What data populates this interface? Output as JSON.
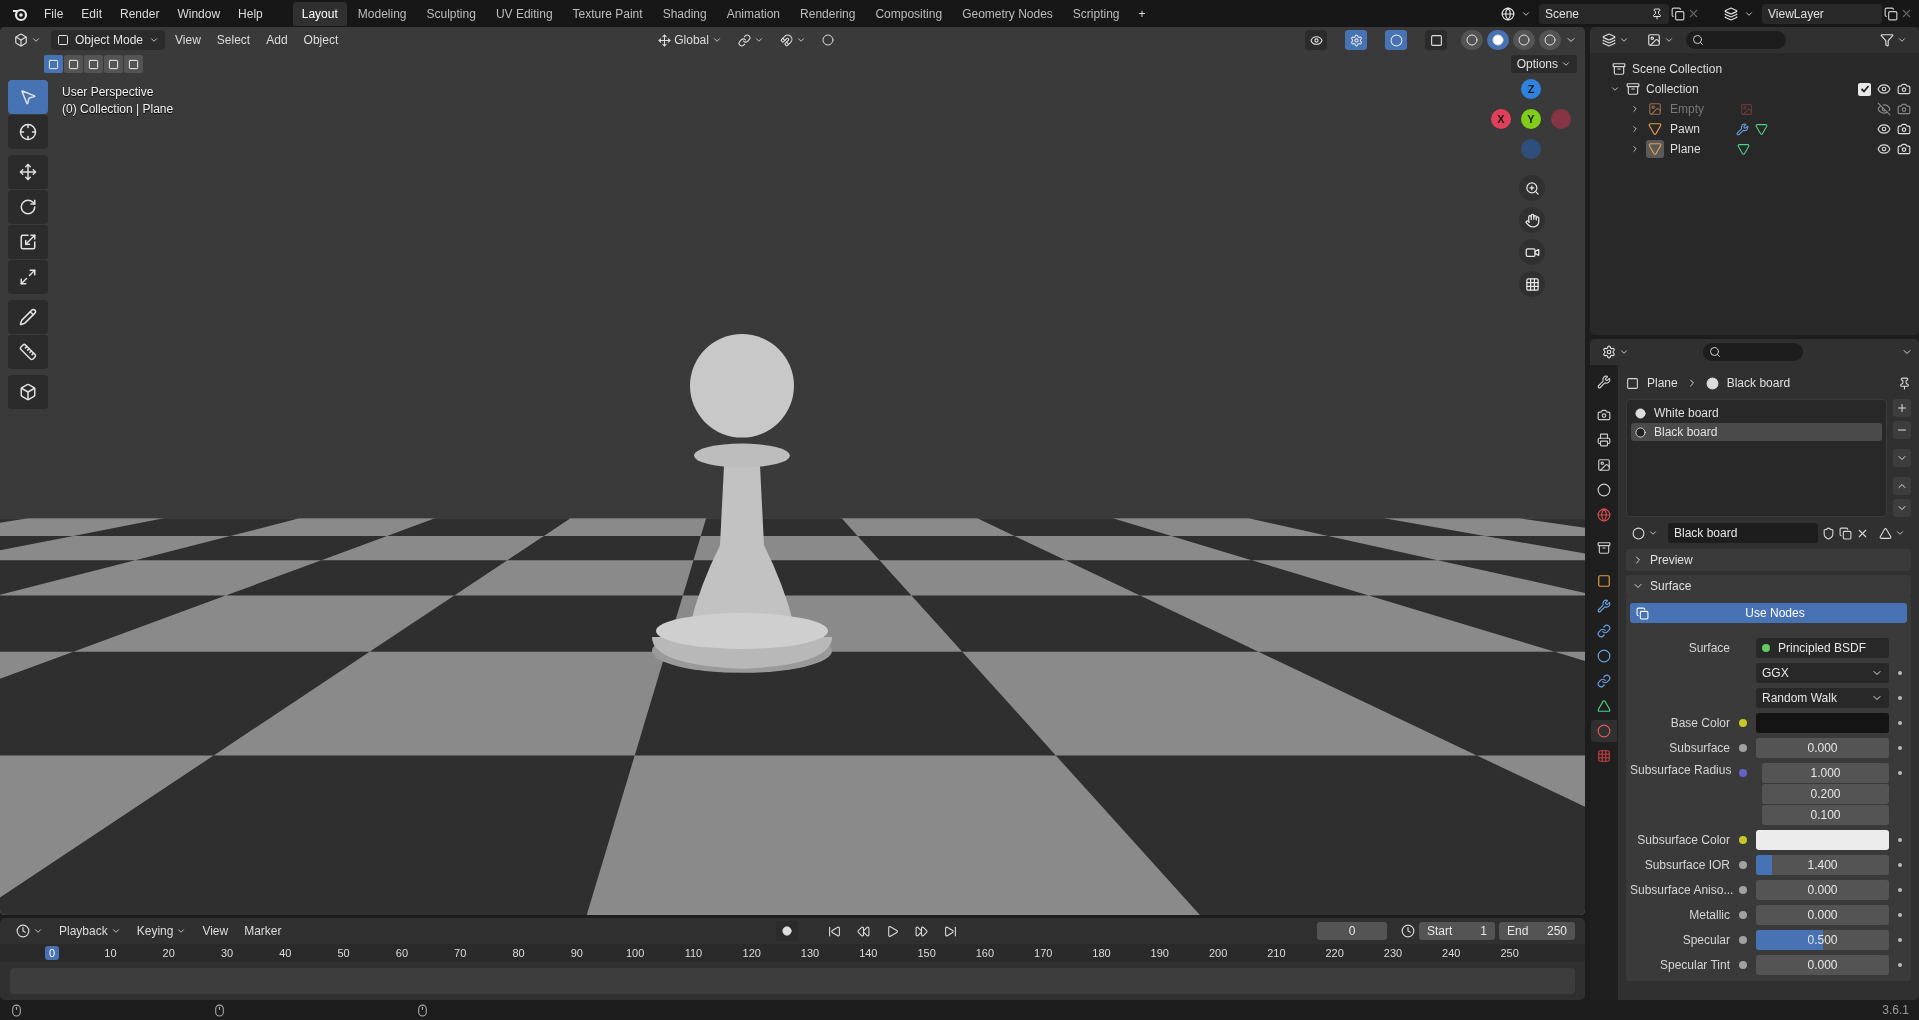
{
  "top_bar": {
    "menus": [
      "File",
      "Edit",
      "Render",
      "Window",
      "Help"
    ],
    "workspaces": [
      {
        "label": "Layout",
        "selected": true
      },
      {
        "label": "Modeling",
        "selected": false
      },
      {
        "label": "Sculpting",
        "selected": false
      },
      {
        "label": "UV Editing",
        "selected": false
      },
      {
        "label": "Texture Paint",
        "selected": false
      },
      {
        "label": "Shading",
        "selected": false
      },
      {
        "label": "Animation",
        "selected": false
      },
      {
        "label": "Rendering",
        "selected": false
      },
      {
        "label": "Compositing",
        "selected": false
      },
      {
        "label": "Geometry Nodes",
        "selected": false
      },
      {
        "label": "Scripting",
        "selected": false
      }
    ],
    "add_workspace": "+",
    "scene": "Scene",
    "view_layer": "ViewLayer"
  },
  "viewport": {
    "mode": "Object Mode",
    "menus": [
      "View",
      "Select",
      "Add",
      "Object"
    ],
    "orientation": "Global",
    "header_toggles": [
      {
        "on": false
      },
      {
        "on": true
      },
      {
        "on": true
      },
      {
        "on": false
      }
    ],
    "shading_modes": [
      {
        "selected": false
      },
      {
        "selected": true
      },
      {
        "selected": false
      },
      {
        "selected": false
      }
    ],
    "select_modes": [
      {
        "selected": true
      },
      {
        "selected": false
      },
      {
        "selected": false
      },
      {
        "selected": false
      },
      {
        "selected": false
      }
    ],
    "options": "Options",
    "info": [
      "User Perspective",
      "(0) Collection | Plane"
    ],
    "tools": [
      {
        "selected": true
      },
      {
        "selected": false
      },
      {
        "selected": false
      },
      {
        "selected": false
      },
      {
        "selected": false
      },
      {
        "selected": false
      },
      {
        "selected": false
      },
      {
        "selected": false
      },
      {
        "selected": false
      }
    ],
    "gizmo": {
      "z": "Z",
      "x": "X",
      "y": "Y"
    }
  },
  "outliner": {
    "root": "Scene Collection",
    "collection": {
      "name": "Collection",
      "checked": true,
      "expanded": true,
      "children": [
        {
          "name": "Empty",
          "kind": "empty",
          "hidden": true,
          "active": false,
          "modifier": false
        },
        {
          "name": "Pawn",
          "kind": "mesh",
          "hidden": false,
          "active": false,
          "modifier": true
        },
        {
          "name": "Plane",
          "kind": "mesh",
          "hidden": false,
          "active": true,
          "modifier": false
        }
      ]
    }
  },
  "properties": {
    "tabs": [
      {
        "selected": false
      },
      {
        "selected": false
      },
      {
        "selected": false
      },
      {
        "selected": false
      },
      {
        "selected": false
      },
      {
        "selected": false
      },
      {
        "selected": false
      },
      {
        "selected": false
      },
      {
        "selected": false
      },
      {
        "selected": false
      },
      {
        "selected": false
      },
      {
        "selected": false
      },
      {
        "selected": false
      },
      {
        "selected": true
      },
      {
        "selected": false
      }
    ],
    "breadcrumb": [
      "Plane",
      "Black board"
    ],
    "slots": [
      {
        "name": "White board",
        "selected": false
      },
      {
        "name": "Black board",
        "selected": true
      }
    ],
    "material": "Black board",
    "panels": [
      {
        "title": "Preview",
        "expanded": false
      },
      {
        "title": "Surface",
        "expanded": true
      }
    ],
    "use_nodes": "Use Nodes",
    "rows": [
      {
        "kind": "link",
        "label": "Surface",
        "value": "Principled BSDF"
      },
      {
        "kind": "dropdown",
        "value": "GGX"
      },
      {
        "kind": "dropdown",
        "value": "Random Walk"
      },
      {
        "kind": "color",
        "label": "Base Color",
        "color": "#141414"
      },
      {
        "kind": "number",
        "label": "Subsurface",
        "value": "0.000"
      },
      {
        "kind": "vector",
        "label": "Subsurface Radius",
        "values": [
          "1.000",
          "0.200",
          "0.100"
        ]
      },
      {
        "kind": "color",
        "label": "Subsurface Color",
        "color": "#ececec"
      },
      {
        "kind": "slider",
        "label": "Subsurface IOR",
        "value": "1.400",
        "level": 0.12
      },
      {
        "kind": "number",
        "label": "Subsurface Aniso...",
        "value": "0.000"
      },
      {
        "kind": "number",
        "label": "Metallic",
        "value": "0.000"
      },
      {
        "kind": "slider",
        "label": "Specular",
        "value": "0.500",
        "level": 0.5
      },
      {
        "kind": "number",
        "label": "Specular Tint",
        "value": "0.000"
      }
    ]
  },
  "timeline": {
    "menus": [
      "Playback",
      "Keying",
      "View",
      "Marker"
    ],
    "current": "0",
    "start_label": "Start",
    "start": "1",
    "end_label": "End",
    "end": "250",
    "frames": [
      {
        "label": "0",
        "selected": true
      },
      {
        "label": "10",
        "selected": false
      },
      {
        "label": "20",
        "selected": false
      },
      {
        "label": "30",
        "selected": false
      },
      {
        "label": "40",
        "selected": false
      },
      {
        "label": "50",
        "selected": false
      },
      {
        "label": "60",
        "selected": false
      },
      {
        "label": "70",
        "selected": false
      },
      {
        "label": "80",
        "selected": false
      },
      {
        "label": "90",
        "selected": false
      },
      {
        "label": "100",
        "selected": false
      },
      {
        "label": "110",
        "selected": false
      },
      {
        "label": "120",
        "selected": false
      },
      {
        "label": "130",
        "selected": false
      },
      {
        "label": "140",
        "selected": false
      },
      {
        "label": "150",
        "selected": false
      },
      {
        "label": "160",
        "selected": false
      },
      {
        "label": "170",
        "selected": false
      },
      {
        "label": "180",
        "selected": false
      },
      {
        "label": "190",
        "selected": false
      },
      {
        "label": "200",
        "selected": false
      },
      {
        "label": "210",
        "selected": false
      },
      {
        "label": "220",
        "selected": false
      },
      {
        "label": "230",
        "selected": false
      },
      {
        "label": "240",
        "selected": false
      },
      {
        "label": "250",
        "selected": false
      }
    ]
  },
  "status_bar": {
    "version": "3.6.1"
  }
}
